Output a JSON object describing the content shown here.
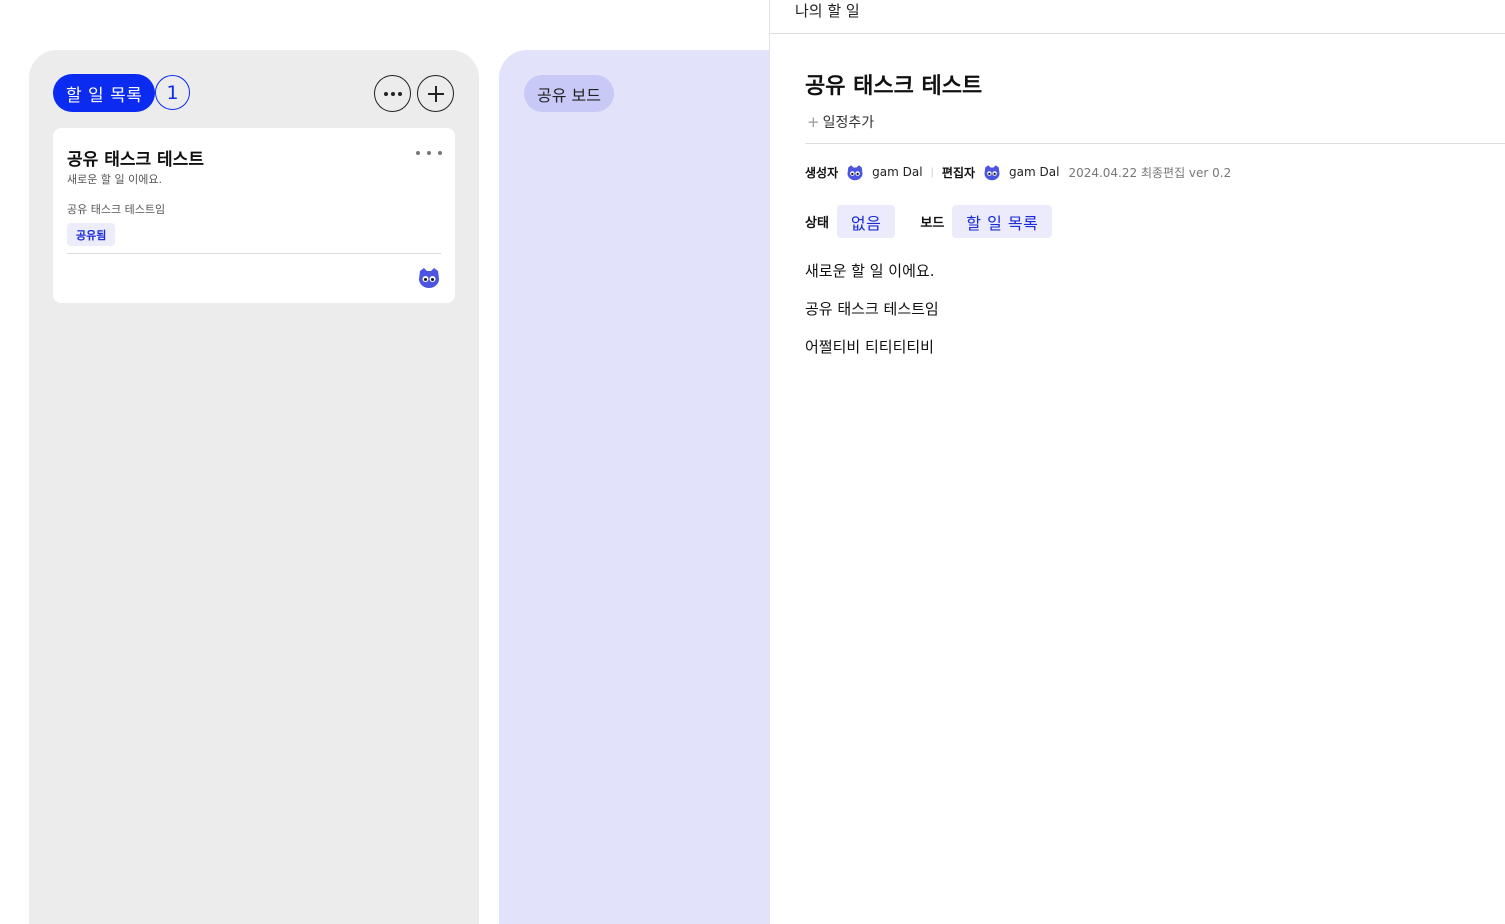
{
  "board_todo": {
    "title": "할 일 목록",
    "count": "1",
    "more_icon": "more-horizontal-icon",
    "add_icon": "plus-icon",
    "card": {
      "title": "공유 태스크 테스트",
      "subtitle": "새로운 할 일 이에요.",
      "description": "공유 태스크 테스트임",
      "tag": "공유됨",
      "more_icon": "more-horizontal-icon",
      "avatar_icon": "cat-avatar-icon"
    }
  },
  "board_shared": {
    "title": "공유 보드"
  },
  "detail": {
    "header_title": "나의 할 일",
    "title": "공유 태스크 테스트",
    "add_schedule": "일정추가",
    "creator_label": "생성자",
    "creator_name": "gam Dal",
    "editor_label": "편집자",
    "editor_name": "gam Dal",
    "last_edit": "2024.04.22 최종편집 ver 0.2",
    "status_label": "상태",
    "status_value": "없음",
    "board_label": "보드",
    "board_value": "할 일 목록",
    "body_lines": [
      "새로운 할 일 이에요.",
      "공유 태스크 테스트임",
      "어쩔티비 티티티티비"
    ]
  },
  "colors": {
    "accent": "#0b2cf0",
    "todo_column_bg": "#ececec",
    "shared_column_bg": "#e2e3fa",
    "tag_bg": "#ececfb",
    "avatar": "#4b55e0"
  }
}
